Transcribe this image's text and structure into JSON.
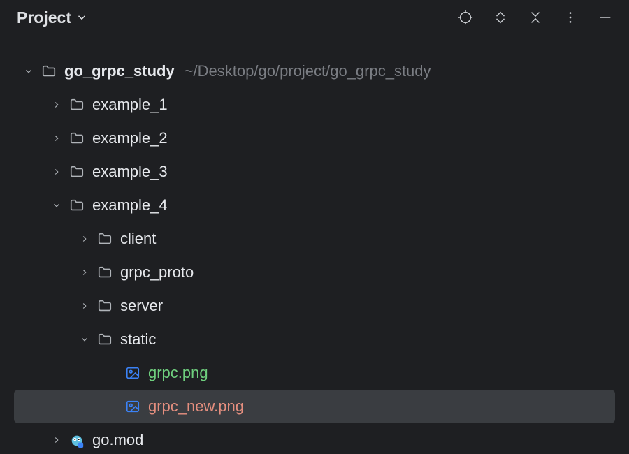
{
  "panel": {
    "title": "Project"
  },
  "tree": {
    "root": {
      "name": "go_grpc_study",
      "path_suffix": "~/Desktop/go/project/go_grpc_study"
    },
    "items": {
      "example_1": "example_1",
      "example_2": "example_2",
      "example_3": "example_3",
      "example_4": "example_4",
      "client": "client",
      "grpc_proto": "grpc_proto",
      "server": "server",
      "static": "static",
      "grpc_png": "grpc.png",
      "grpc_new_png": "grpc_new.png",
      "go_mod": "go.mod"
    }
  }
}
